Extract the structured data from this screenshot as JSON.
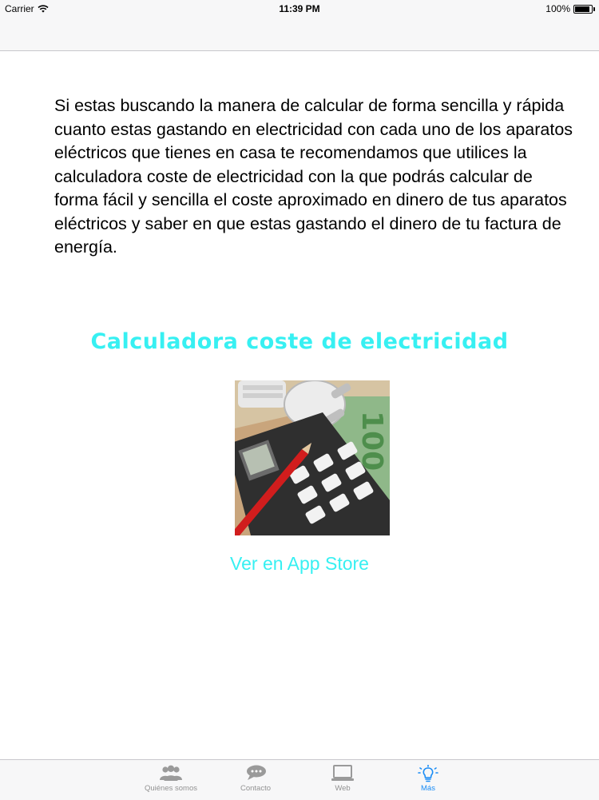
{
  "status_bar": {
    "carrier": "Carrier",
    "time": "11:39 PM",
    "battery": "100%",
    "battery_level": 1.0
  },
  "main": {
    "intro_text": "Si estas buscando la manera de calcular de forma sencilla y rápida cuanto estas gastando en electricidad con cada uno de los aparatos eléctricos que tienes en casa te recomendamos que utilices la calculadora coste de electricidad con la que podrás calcular de forma fácil y sencilla el coste aproximado en dinero de tus aparatos eléctricos y saber en que estas gastando el dinero de tu factura de energía.",
    "promo_title": "Calculadora coste de electricidad",
    "app_store_link": "Ver en App Store",
    "accent_color": "#37f0f2"
  },
  "tab_bar": {
    "active_color": "#1a8cf5",
    "inactive_color": "#929292",
    "tabs": [
      {
        "label": "Quiénes somos",
        "icon": "people-icon"
      },
      {
        "label": "Contacto",
        "icon": "chat-bubbles-icon"
      },
      {
        "label": "Web",
        "icon": "laptop-icon"
      },
      {
        "label": "Más",
        "icon": "lightbulb-icon",
        "active": true
      }
    ]
  }
}
